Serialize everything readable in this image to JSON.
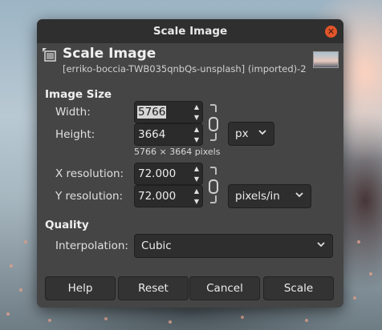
{
  "window": {
    "title": "Scale Image"
  },
  "header": {
    "title": "Scale Image",
    "subtitle": "[erriko-boccia-TWB035qnbQs-unsplash] (imported)-2"
  },
  "image_size": {
    "section_label": "Image Size",
    "width_label": "Width:",
    "width_value": "5766",
    "height_label": "Height:",
    "height_value": "3664",
    "unit": "px",
    "dimensions_text": "5766 × 3664 pixels",
    "x_res_label": "X resolution:",
    "x_res_value": "72.000",
    "y_res_label": "Y resolution:",
    "y_res_value": "72.000",
    "res_unit": "pixels/in"
  },
  "quality": {
    "section_label": "Quality",
    "interpolation_label": "Interpolation:",
    "interpolation_value": "Cubic"
  },
  "buttons": {
    "help": "Help",
    "reset": "Reset",
    "cancel": "Cancel",
    "scale": "Scale"
  },
  "colors": {
    "dialog_bg": "#454545",
    "titlebar_bg": "#2f2f2f",
    "close_button": "#e2552a",
    "field_bg": "#2b2b2b"
  },
  "icons": [
    "scale-image-icon",
    "close-icon",
    "chain-link-icon",
    "chevron-down-icon",
    "spin-up-icon",
    "spin-down-icon"
  ]
}
